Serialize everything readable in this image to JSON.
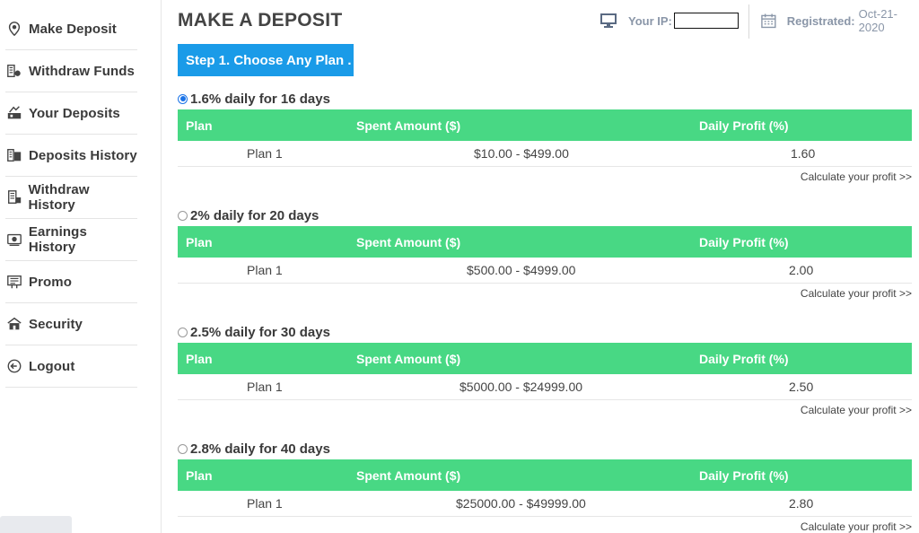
{
  "sidebar": {
    "items": [
      {
        "label": "Make Deposit",
        "icon": "map-pin-icon"
      },
      {
        "label": "Withdraw Funds",
        "icon": "withdraw-icon"
      },
      {
        "label": "Your Deposits",
        "icon": "deposits-icon"
      },
      {
        "label": "Deposits History",
        "icon": "history-icon"
      },
      {
        "label": "Withdraw History",
        "icon": "withdraw-history-icon"
      },
      {
        "label": "Earnings History",
        "icon": "earnings-icon"
      },
      {
        "label": "Promo",
        "icon": "promo-icon"
      },
      {
        "label": "Security",
        "icon": "security-icon"
      },
      {
        "label": "Logout",
        "icon": "logout-icon"
      }
    ]
  },
  "header": {
    "title": "MAKE A DEPOSIT",
    "ip_label": "Your IP:",
    "registered_label": "Registrated:",
    "registered_date": "Oct-21-2020"
  },
  "step_label": "Step 1. Choose Any Plan .",
  "table_headers": {
    "plan": "Plan",
    "amount": "Spent Amount ($)",
    "profit": "Daily Profit (%)"
  },
  "calc_label": "Calculate your profit >>",
  "plans": [
    {
      "name": "1.6% daily for 16 days",
      "selected": true,
      "row": {
        "plan": "Plan 1",
        "amount": "$10.00 - $499.00",
        "profit": "1.60"
      }
    },
    {
      "name": "2% daily for 20 days",
      "selected": false,
      "row": {
        "plan": "Plan 1",
        "amount": "$500.00 - $4999.00",
        "profit": "2.00"
      }
    },
    {
      "name": "2.5% daily for 30 days",
      "selected": false,
      "row": {
        "plan": "Plan 1",
        "amount": "$5000.00 - $24999.00",
        "profit": "2.50"
      }
    },
    {
      "name": "2.8% daily for 40 days",
      "selected": false,
      "row": {
        "plan": "Plan 1",
        "amount": "$25000.00 - $49999.00",
        "profit": "2.80"
      }
    }
  ],
  "colors": {
    "accent_blue": "#1a9be8",
    "table_green": "#48d884"
  }
}
